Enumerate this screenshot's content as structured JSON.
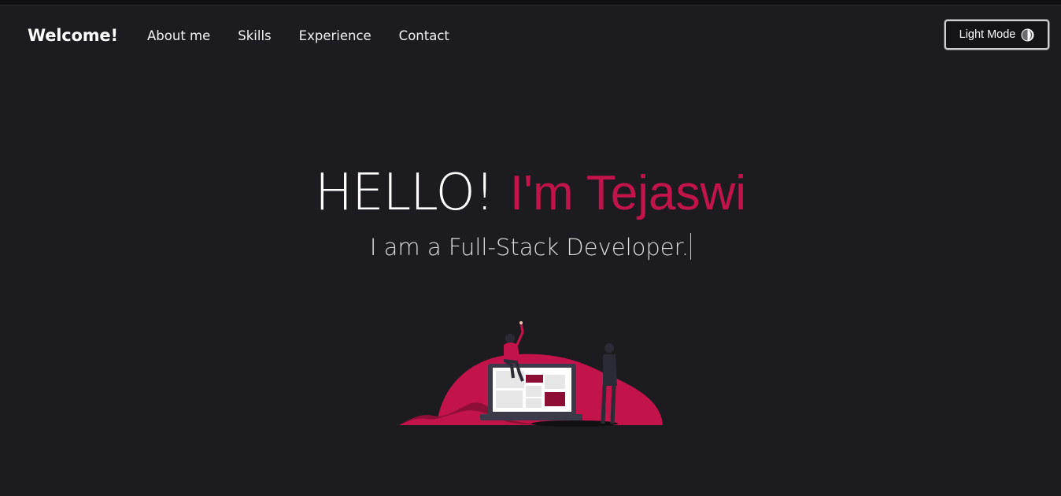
{
  "navbar": {
    "brand": "Welcome!",
    "links": [
      "About me",
      "Skills",
      "Experience",
      "Contact"
    ],
    "theme_toggle": {
      "label": "Light Mode",
      "icon": "half-circle-contrast-icon"
    }
  },
  "hero": {
    "greeting": "HELLO!",
    "name": "I'm Tejaswi",
    "subtitle": "I am a Full-Stack Developer.",
    "illustration": "developer-laptop-illustration"
  },
  "colors": {
    "background": "#1c1b20",
    "accent": "#c2134a",
    "text": "#ffffff"
  }
}
